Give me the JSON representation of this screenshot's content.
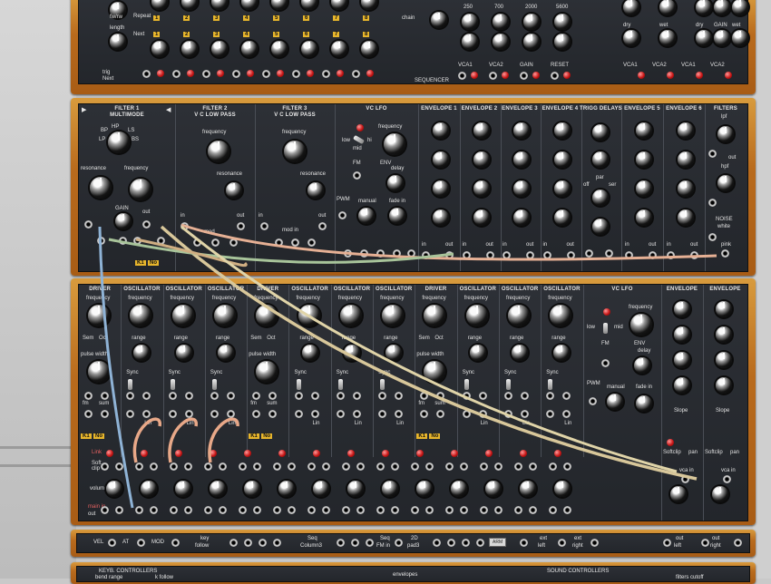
{
  "top": {
    "labels": {
      "fwrw": "fw/rw",
      "length": "length",
      "repeat": "Repeat",
      "next": "Next",
      "trig": "trig",
      "next2": "Next",
      "chain": "chain",
      "sequencer": "SEQUENCER",
      "link": "Link"
    },
    "steps": [
      "1",
      "2",
      "3",
      "4",
      "5",
      "6",
      "7",
      "8"
    ],
    "freqs": [
      "250",
      "700",
      "2000",
      "5600"
    ],
    "vca": [
      "VCA1",
      "VCA2",
      "GAIN",
      "RESET"
    ],
    "right": [
      "dry",
      "wet",
      "dry",
      "GAIN",
      "wet"
    ],
    "vca_right": [
      "VCA1",
      "VCA2",
      "VCA1",
      "VCA2"
    ]
  },
  "row1": {
    "filter1": {
      "title": "FILTER 1",
      "sub": "MULTIMODE",
      "bp": "BP",
      "hp": "HP",
      "ls": "LS",
      "lp": "LP",
      "bs": "BS",
      "resonance": "resonance",
      "frequency": "frequency",
      "gain": "GAIN",
      "out": "out",
      "in": "in"
    },
    "filter2": {
      "title": "FILTER 2",
      "sub": "V C LOW PASS",
      "frequency": "frequency",
      "resonance": "resonance",
      "in": "in",
      "out": "out",
      "mod": "mod"
    },
    "filter3": {
      "title": "FILTER 3",
      "sub": "V C LOW PASS",
      "frequency": "frequency",
      "resonance": "resonance",
      "in": "in",
      "out": "out",
      "modin": "mod in"
    },
    "vclfo": {
      "title": "VC LFO",
      "frequency": "frequency",
      "low": "low",
      "mid": "mid",
      "hi": "hi",
      "fm": "FM",
      "env": "ENV",
      "delay": "delay",
      "manual": "manual",
      "fadein": "fade in",
      "pwm": "PWM"
    },
    "envs": [
      "ENVELOPE 1",
      "ENVELOPE 2",
      "ENVELOPE 3",
      "ENVELOPE 4"
    ],
    "trigg": {
      "title": "TRIGG DELAYS",
      "off": "off",
      "par": "par",
      "ser": "ser"
    },
    "envs2": [
      "ENVELOPE 5",
      "ENVELOPE 6"
    ],
    "filters": {
      "title": "FILTERS",
      "lpf": "lpf",
      "hpf": "hpf",
      "noise": "NOISE",
      "white": "white",
      "pink": "pink"
    },
    "tags": [
      "K1",
      "No"
    ],
    "env_in": "in",
    "env_out": "out"
  },
  "row2": {
    "titles": [
      "DRIVER",
      "OSCILLATOR",
      "OSCILLATOR",
      "OSCILLATOR",
      "DRIVER",
      "OSCILLATOR",
      "OSCILLATOR",
      "OSCILLATOR",
      "DRIVER",
      "OSCILLATOR",
      "OSCILLATOR",
      "OSCILLATOR"
    ],
    "frequency": "frequency",
    "range": "range",
    "sync": "Sync",
    "pulsewidth": "pulse width",
    "semi": "Sem",
    "oct": "Oct",
    "fm": "fm",
    "sum": "sum",
    "lin": "Lin",
    "vclfo": {
      "title": "VC LFO",
      "frequency": "frequency",
      "low": "low",
      "mid": "mid",
      "fm": "FM",
      "env": "ENV",
      "delay": "delay",
      "manual": "manual",
      "fadein": "fade in",
      "pwm": "PWM"
    },
    "envelope1": "ENVELOPE",
    "envelope2": "ENVELOPE",
    "slope": "Slope",
    "softclip": "Softclip",
    "pan": "pan",
    "vcain": "vca in",
    "link": "Link",
    "soft": "Soft",
    "clip": "clip",
    "volume": "volume",
    "mainin": "main in",
    "out": "out",
    "tags": [
      "K1",
      "No"
    ]
  },
  "bottom": {
    "vel": "VEL",
    "at": "AT",
    "mod": "MOD",
    "key": "key",
    "follow": "follow",
    "seq": "Seq",
    "column3": "Column3",
    "seq2": "Seq",
    "fmin": "FM in",
    "twod": "2D",
    "pad3": "pad3",
    "btn": "ARM",
    "ext": "ext",
    "left": "left",
    "right": "right",
    "out": "out",
    "keyb": "KEYB. CONTROLLERS",
    "bendrange": "bend range",
    "kfollow": "k follow",
    "envelopes": "envelopes",
    "sound": "SOUND CONTROLLERS",
    "filtcut": "filters cutoff"
  }
}
